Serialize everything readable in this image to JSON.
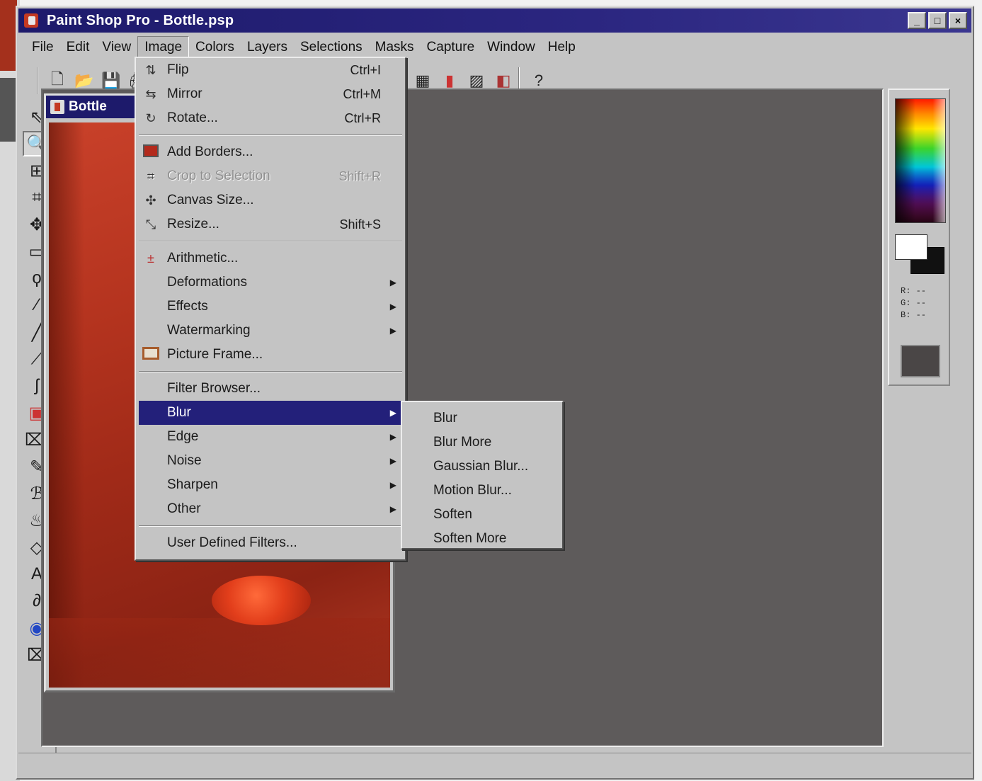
{
  "window": {
    "title": "Paint Shop Pro - Bottle.psp",
    "buttons": [
      "_",
      "□",
      "×"
    ]
  },
  "menubar": [
    {
      "label": "File"
    },
    {
      "label": "Edit"
    },
    {
      "label": "View"
    },
    {
      "label": "Image",
      "open": true
    },
    {
      "label": "Colors"
    },
    {
      "label": "Layers"
    },
    {
      "label": "Selections"
    },
    {
      "label": "Masks"
    },
    {
      "label": "Capture"
    },
    {
      "label": "Window"
    },
    {
      "label": "Help"
    }
  ],
  "toolbar": {
    "icons": [
      "new-icon",
      "open-icon",
      "save-icon",
      "print-icon",
      "palette-icon",
      "histogram-icon",
      "image-icon",
      "layers-icon",
      "help-icon"
    ]
  },
  "document": {
    "title": "Bottle"
  },
  "image_menu": {
    "items": [
      {
        "label": "Flip",
        "shortcut": "Ctrl+I",
        "icon": "flip-icon"
      },
      {
        "label": "Mirror",
        "shortcut": "Ctrl+M",
        "icon": "mirror-icon"
      },
      {
        "label": "Rotate...",
        "shortcut": "Ctrl+R",
        "icon": "rotate-icon"
      },
      {
        "label": "Add Borders...",
        "shortcut": "",
        "icon": "add-borders-icon"
      },
      {
        "label": "Crop to Selection",
        "shortcut": "Shift+R",
        "icon": "crop-icon",
        "disabled": true
      },
      {
        "label": "Canvas Size...",
        "shortcut": "",
        "icon": "canvas-size-icon"
      },
      {
        "label": "Resize...",
        "shortcut": "Shift+S",
        "icon": "resize-icon"
      },
      {
        "label": "Arithmetic...",
        "shortcut": "",
        "icon": "arithmetic-icon"
      },
      {
        "label": "Deformations",
        "submenu": true
      },
      {
        "label": "Effects",
        "submenu": true
      },
      {
        "label": "Watermarking",
        "submenu": true
      },
      {
        "label": "Picture Frame...",
        "icon": "picture-frame-icon"
      },
      {
        "label": "Filter Browser..."
      },
      {
        "label": "Blur",
        "submenu": true,
        "highlighted": true
      },
      {
        "label": "Edge",
        "submenu": true
      },
      {
        "label": "Noise",
        "submenu": true
      },
      {
        "label": "Sharpen",
        "submenu": true
      },
      {
        "label": "Other",
        "submenu": true
      },
      {
        "label": "User Defined Filters..."
      }
    ]
  },
  "blur_menu": {
    "items": [
      "Blur",
      "Blur More",
      "Gaussian Blur...",
      "Motion Blur...",
      "Soften",
      "Soften More"
    ]
  },
  "palette": {
    "rgb_readout": [
      "R: --",
      "G: --",
      "B: --"
    ],
    "foreground_color": "#ffffff",
    "background_color": "#111111"
  },
  "colors": {
    "title_bar": "#1d1a6b",
    "menu_highlight": "#23207a",
    "workspace": "#5e5b5b",
    "chrome": "#c4c4c4"
  }
}
